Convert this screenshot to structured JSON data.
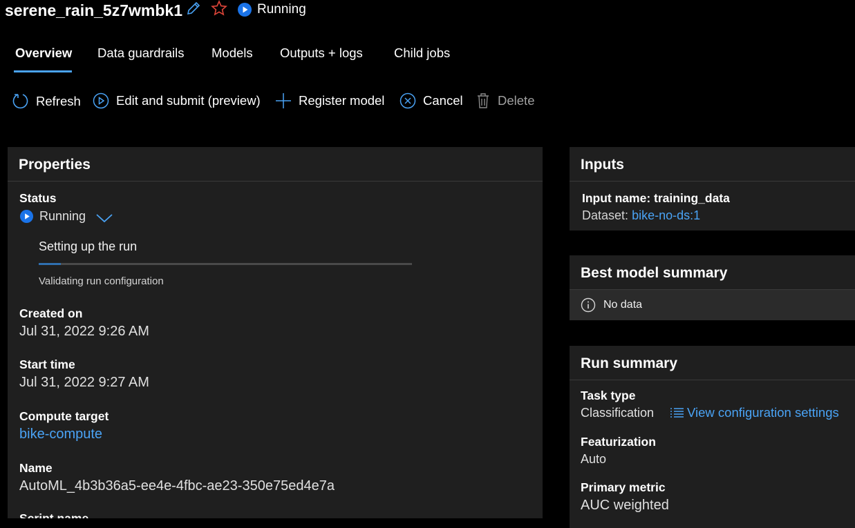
{
  "header": {
    "title": "serene_rain_5z7wmbk1",
    "status": "Running"
  },
  "tabs": [
    {
      "label": "Overview"
    },
    {
      "label": "Data guardrails"
    },
    {
      "label": "Models"
    },
    {
      "label": "Outputs + logs"
    },
    {
      "label": "Child jobs"
    }
  ],
  "toolbar": {
    "refresh": "Refresh",
    "edit_submit": "Edit and submit (preview)",
    "register_model": "Register model",
    "cancel": "Cancel",
    "delete": "Delete"
  },
  "properties": {
    "title": "Properties",
    "status_label": "Status",
    "status_value": "Running",
    "step_title": "Setting up the run",
    "step_detail": "Validating run configuration",
    "created_label": "Created on",
    "created_value": "Jul 31, 2022 9:26 AM",
    "start_label": "Start time",
    "start_value": "Jul 31, 2022 9:27 AM",
    "compute_label": "Compute target",
    "compute_value": "bike-compute",
    "name_label": "Name",
    "name_value": "AutoML_4b3b36a5-ee4e-4fbc-ae23-350e75ed4e7a",
    "script_label": "Script name"
  },
  "inputs": {
    "title": "Inputs",
    "input_name": "Input name: training_data",
    "dataset_prefix": "Dataset:",
    "dataset_link": "bike-no-ds:1"
  },
  "best_model": {
    "title": "Best model summary",
    "no_data": "No data"
  },
  "run_summary": {
    "title": "Run summary",
    "task_type_label": "Task type",
    "task_type_value": "Classification",
    "view_config": "View configuration settings",
    "featurization_label": "Featurization",
    "featurization_value": "Auto",
    "primary_metric_label": "Primary metric",
    "primary_metric_value": "AUC weighted"
  },
  "colors": {
    "accent": "#4aa3f5",
    "running_blue": "#1a73e8",
    "star_red": "#e0463a",
    "panel_bg": "#1f1f1f"
  }
}
